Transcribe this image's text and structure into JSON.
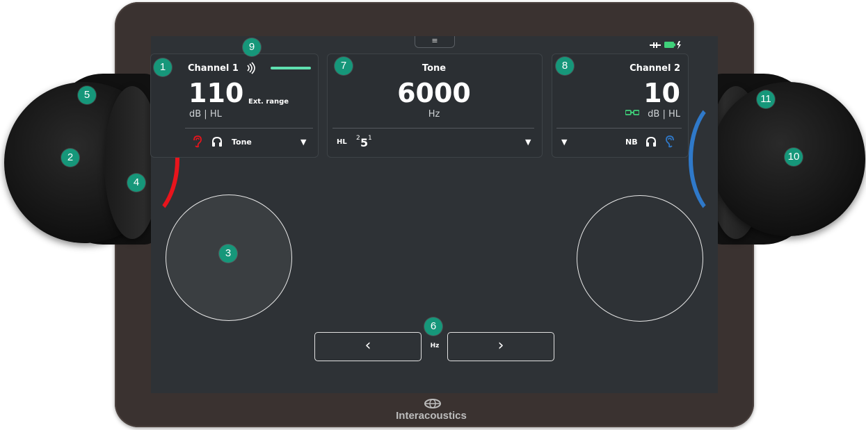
{
  "menu_tab": {
    "icon": "≡"
  },
  "status": {
    "icons": [
      "plug-icon",
      "battery-charging-icon"
    ],
    "battery_color": "#3fd17a"
  },
  "channel1": {
    "title": "Channel 1",
    "level": "110",
    "unit": "dB | HL",
    "ext_range": "Ext. range",
    "signal": "Tone",
    "accent_color": "#e8141c"
  },
  "tone_panel": {
    "title": "Tone",
    "frequency": "6000",
    "unit": "Hz",
    "mode": "HL",
    "step_sup": "2",
    "step_main": "5",
    "step_sup2": "1"
  },
  "channel2": {
    "title": "Channel 2",
    "level": "10",
    "unit": "dB | HL",
    "signal": "NB",
    "accent_color": "#2f79c9"
  },
  "navigation": {
    "prev": "‹",
    "next": "›",
    "label": "Hz"
  },
  "callouts": [
    "1",
    "2",
    "3",
    "4",
    "5",
    "6",
    "7",
    "8",
    "9",
    "10",
    "11"
  ],
  "brand": {
    "name": "Interacoustics"
  },
  "colors": {
    "callout": "#16977a",
    "screen": "#2e3236",
    "progress": "#5fe0b0"
  }
}
